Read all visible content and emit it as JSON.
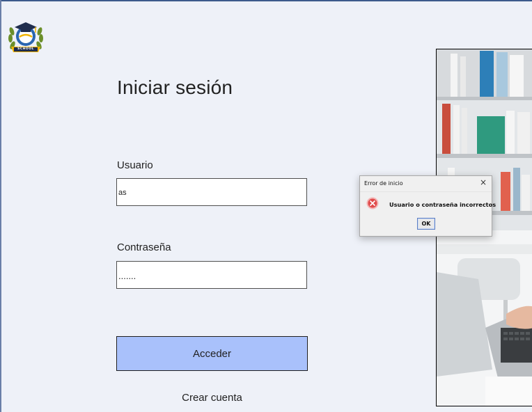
{
  "login": {
    "title": "Iniciar sesión",
    "username_label": "Usuario",
    "username_value": "as",
    "password_label": "Contraseña",
    "password_value": ".......",
    "submit_label": "Acceder",
    "create_account_label": "Crear cuenta"
  },
  "logo": {
    "icon": "graduation-cap-laurel-logo",
    "text": "SCHOOL"
  },
  "dialog": {
    "title": "Error de inicio",
    "close_label": "×",
    "message": "Usuario o contraseña incorrectos",
    "ok_label": "OK",
    "icon": "error-icon"
  },
  "colors": {
    "background": "#eef1f8",
    "button": "#a9c1fb",
    "error_icon": "#e04a4a"
  }
}
